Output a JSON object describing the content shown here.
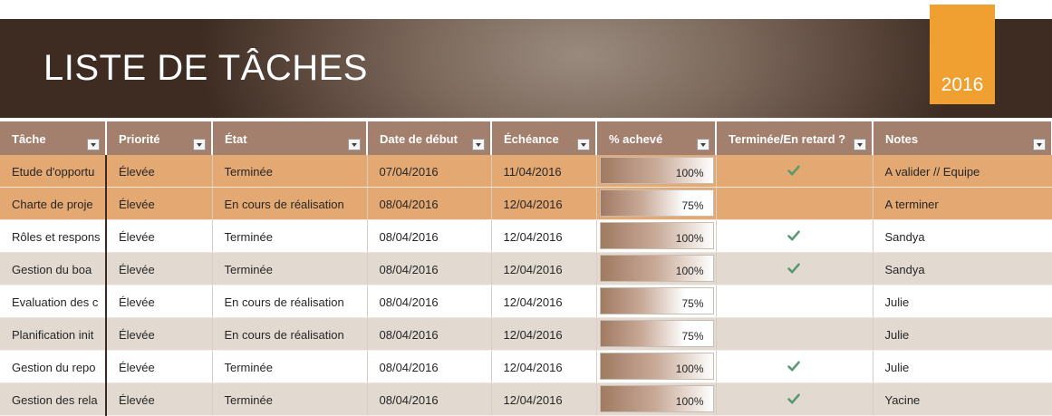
{
  "banner": {
    "title": "LISTE DE TÂCHES",
    "year": "2016"
  },
  "columns": [
    {
      "label": "Tâche"
    },
    {
      "label": "Priorité"
    },
    {
      "label": "État"
    },
    {
      "label": "Date de début"
    },
    {
      "label": "Échéance"
    },
    {
      "label": "% achevé"
    },
    {
      "label": "Terminée/En retard ?"
    },
    {
      "label": "Notes"
    }
  ],
  "rows": [
    {
      "task": "Etude d'opportu",
      "priority": "Élevée",
      "status": "Terminée",
      "start": "07/04/2016",
      "due": "11/04/2016",
      "percent": "100%",
      "progress": 1.0,
      "done": true,
      "notes": "A valider // Equipe",
      "style": "orange"
    },
    {
      "task": "Charte de proje",
      "priority": "Élevée",
      "status": "En cours de réalisation",
      "start": "08/04/2016",
      "due": "12/04/2016",
      "percent": "75%",
      "progress": 0.75,
      "done": false,
      "notes": "A terminer",
      "style": "orange"
    },
    {
      "task": "Rôles et respons",
      "priority": "Élevée",
      "status": "Terminée",
      "start": "08/04/2016",
      "due": "12/04/2016",
      "percent": "100%",
      "progress": 1.0,
      "done": true,
      "notes": "Sandya",
      "style": "white"
    },
    {
      "task": "Gestion du boa",
      "priority": "Élevée",
      "status": "Terminée",
      "start": "08/04/2016",
      "due": "12/04/2016",
      "percent": "100%",
      "progress": 1.0,
      "done": true,
      "notes": "Sandya",
      "style": "tan"
    },
    {
      "task": "Evaluation des c",
      "priority": "Élevée",
      "status": "En cours de réalisation",
      "start": "08/04/2016",
      "due": "12/04/2016",
      "percent": "75%",
      "progress": 0.75,
      "done": false,
      "notes": "Julie",
      "style": "white"
    },
    {
      "task": "Planification init",
      "priority": "Élevée",
      "status": "En cours de réalisation",
      "start": "08/04/2016",
      "due": "12/04/2016",
      "percent": "75%",
      "progress": 0.75,
      "done": false,
      "notes": "Julie",
      "style": "tan"
    },
    {
      "task": "Gestion du repo",
      "priority": "Élevée",
      "status": "Terminée",
      "start": "08/04/2016",
      "due": "12/04/2016",
      "percent": "100%",
      "progress": 1.0,
      "done": true,
      "notes": "Julie",
      "style": "white"
    },
    {
      "task": "Gestion des rela",
      "priority": "Élevée",
      "status": "Terminée",
      "start": "08/04/2016",
      "due": "12/04/2016",
      "percent": "100%",
      "progress": 1.0,
      "done": true,
      "notes": "Yacine",
      "style": "tan"
    }
  ],
  "icons": {
    "filter": "dropdown-filter-icon",
    "check": "checkmark-icon"
  },
  "colors": {
    "header": "#a37f6d",
    "year_box": "#f0a030",
    "row_orange": "#e4a873",
    "row_tan": "#e2d9d1",
    "check": "#5a9a6e"
  }
}
